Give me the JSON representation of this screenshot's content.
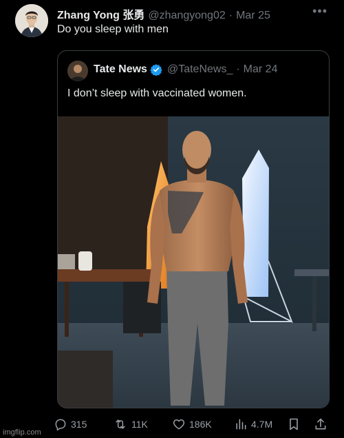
{
  "post": {
    "author_name": "Zhang Yong 张勇",
    "author_handle": "@zhangyong02",
    "separator": "·",
    "date": "Mar 25",
    "more_label": "•••",
    "text": "Do you sleep with men"
  },
  "quote": {
    "author_name": "Tate News",
    "verified": true,
    "author_handle": "@TateNews_",
    "separator": "·",
    "date": "Mar 24",
    "text": "I don’t sleep with vaccinated women.",
    "media": "photo"
  },
  "actions": {
    "reply_icon": "reply-icon",
    "reply_count": "315",
    "repost_icon": "repost-icon",
    "repost_count": "11K",
    "like_icon": "heart-icon",
    "like_count": "186K",
    "views_icon": "views-bar-icon",
    "views_count": "4.7M",
    "bookmark_icon": "bookmark-icon",
    "share_icon": "share-icon"
  },
  "watermark": "imgflip.com",
  "colors": {
    "background": "#000000",
    "primary_text": "#e7e9ea",
    "secondary_text": "#71767b",
    "verified_blue": "#1d9bf0",
    "quote_border": "#3a3f44"
  }
}
